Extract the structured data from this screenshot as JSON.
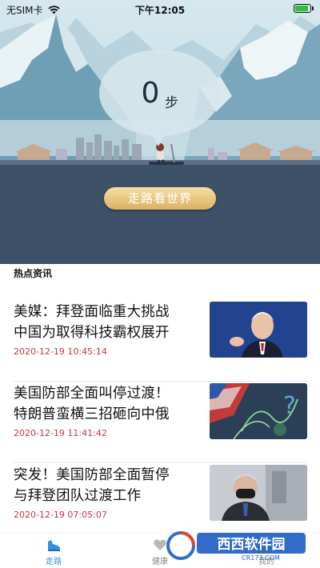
{
  "status_bar": {
    "carrier": "无SIM卡",
    "time": "下午12:05",
    "battery_level": 0.9
  },
  "step_counter": {
    "count": "0",
    "unit": "步"
  },
  "walk_button": {
    "label": "走路看世界"
  },
  "section": {
    "title": "热点资讯"
  },
  "news": [
    {
      "title": "美媒：拜登面临重大挑战\n中国为取得科技霸权展开",
      "date": "2020-12-19 10:45:14"
    },
    {
      "title": "美国防部全面叫停过渡！\n特朗普蛮横三招砸向中俄",
      "date": "2020-12-19 11:41:42"
    },
    {
      "title": "突发！美国防部全面暂停\n与拜登团队过渡工作",
      "date": "2020-12-19 07:05:07"
    }
  ],
  "tabs": [
    {
      "label": "走路",
      "icon": "shoe-icon",
      "active": true
    },
    {
      "label": "健康",
      "icon": "health-icon",
      "active": false
    },
    {
      "label": "我的",
      "icon": "profile-icon",
      "active": false
    }
  ],
  "watermark": {
    "text": "西西软件园",
    "url_text": "CR173.COM"
  },
  "colors": {
    "accent": "#2f8fe0",
    "date": "#c5373f",
    "button": "#e2bd6c"
  }
}
